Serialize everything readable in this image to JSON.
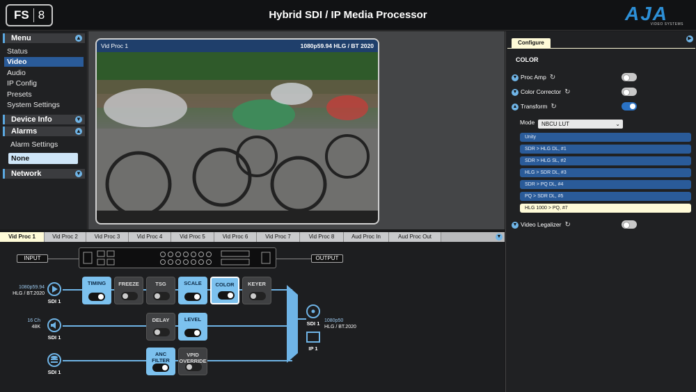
{
  "header": {
    "logo_fs": "FS",
    "logo_num": "8",
    "title": "Hybrid SDI / IP Media Processor",
    "brand": "AJA",
    "brand_sub": "VIDEO SYSTEMS"
  },
  "sidebar": {
    "menu_label": "Menu",
    "items": [
      {
        "label": "Status"
      },
      {
        "label": "Video"
      },
      {
        "label": "Audio"
      },
      {
        "label": "IP Config"
      },
      {
        "label": "Presets"
      },
      {
        "label": "System Settings"
      }
    ],
    "device_info": "Device Info",
    "alarms": "Alarms",
    "alarm_settings": "Alarm Settings",
    "alarm_value": "None",
    "network": "Network"
  },
  "preview": {
    "title": "Vid Proc 1",
    "format": "1080p59.94 HLG / BT 2020"
  },
  "tabs": [
    {
      "label": "Vid Proc 1"
    },
    {
      "label": "Vid Proc 2"
    },
    {
      "label": "Vid Proc 3"
    },
    {
      "label": "Vid Proc 4"
    },
    {
      "label": "Vid Proc 5"
    },
    {
      "label": "Vid Proc 6"
    },
    {
      "label": "Vid Proc 7"
    },
    {
      "label": "Vid Proc 8"
    },
    {
      "label": "Aud Proc In"
    },
    {
      "label": "Aud Proc Out"
    }
  ],
  "pipeline": {
    "input_label": "INPUT",
    "output_label": "OUTPUT",
    "sdi_in_fmt": "1080p59.94",
    "sdi_in_fmt2": "HLG / BT.2020",
    "sdi_in_label": "SDI 1",
    "audio_fmt": "16 Ch",
    "audio_fmt2": "48K",
    "audio_label": "SDI 1",
    "anc_label": "SDI 1",
    "out_sdi_label": "SDI 1",
    "out_fmt": "1080p50",
    "out_fmt2": "HLG / BT.2020",
    "out_ip_label": "IP 1",
    "blocks": {
      "timing": "TIMING",
      "freeze": "FREEZE",
      "tsg": "TSG",
      "scale": "SCALE",
      "color": "COLOR",
      "keyer": "KEYER",
      "delay": "DELAY",
      "level": "LEVEL",
      "anc_filter": "ANC FILTER",
      "vpid": "VPID OVERRIDE"
    }
  },
  "configure": {
    "tab": "Configure",
    "section": "COLOR",
    "proc_amp": "Proc Amp",
    "color_corrector": "Color Corrector",
    "transform": "Transform",
    "video_legalizer": "Video Legalizer",
    "mode_label": "Mode",
    "mode_value": "NBCU LUT",
    "luts": [
      {
        "label": "Unity"
      },
      {
        "label": "SDR > HLG DL, #1"
      },
      {
        "label": "SDR > HLG SL, #2"
      },
      {
        "label": "HLG > SDR DL, #3"
      },
      {
        "label": "SDR > PQ DL, #4"
      },
      {
        "label": "PQ > SDR DL, #5"
      },
      {
        "label": "HLG 1000 > PQ, #7"
      }
    ]
  },
  "colors": {
    "accent": "#6fb4e6",
    "selected": "#2a5b99",
    "highlight": "#fffbd8"
  }
}
